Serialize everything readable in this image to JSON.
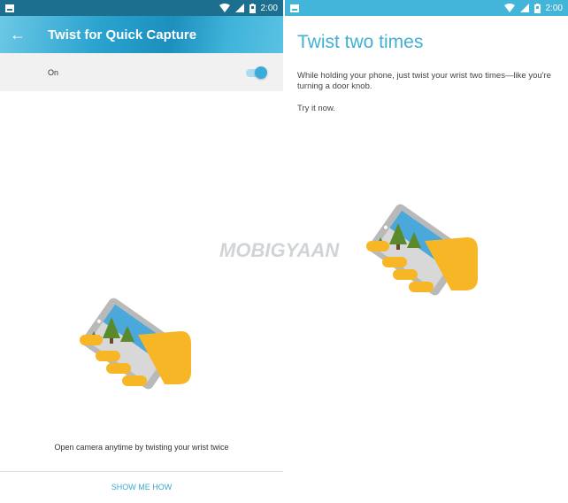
{
  "left": {
    "status_bar": {
      "time": "2:00",
      "icons": [
        "image-icon",
        "wifi-icon",
        "signal-icon",
        "battery-icon"
      ]
    },
    "app_bar": {
      "title": "Twist for Quick Capture",
      "back_icon": "arrow-left-icon"
    },
    "setting": {
      "label": "On",
      "toggle_state": "on"
    },
    "caption": "Open camera anytime by twisting your wrist twice",
    "button": "SHOW ME HOW"
  },
  "right": {
    "status_bar": {
      "time": "2:00",
      "icons": [
        "image-icon",
        "wifi-icon",
        "signal-icon",
        "battery-icon"
      ]
    },
    "title": "Twist two times",
    "body": "While holding your phone, just twist your wrist two times—like you're turning a door knob.",
    "try_text": "Try it now."
  },
  "watermark": "MOBIGYAAN",
  "colors": {
    "accent": "#43b0d5",
    "hand": "#f6b625",
    "phone": "#bdbdbd",
    "sky": "#4aa8db",
    "tree": "#5a8a2c"
  }
}
